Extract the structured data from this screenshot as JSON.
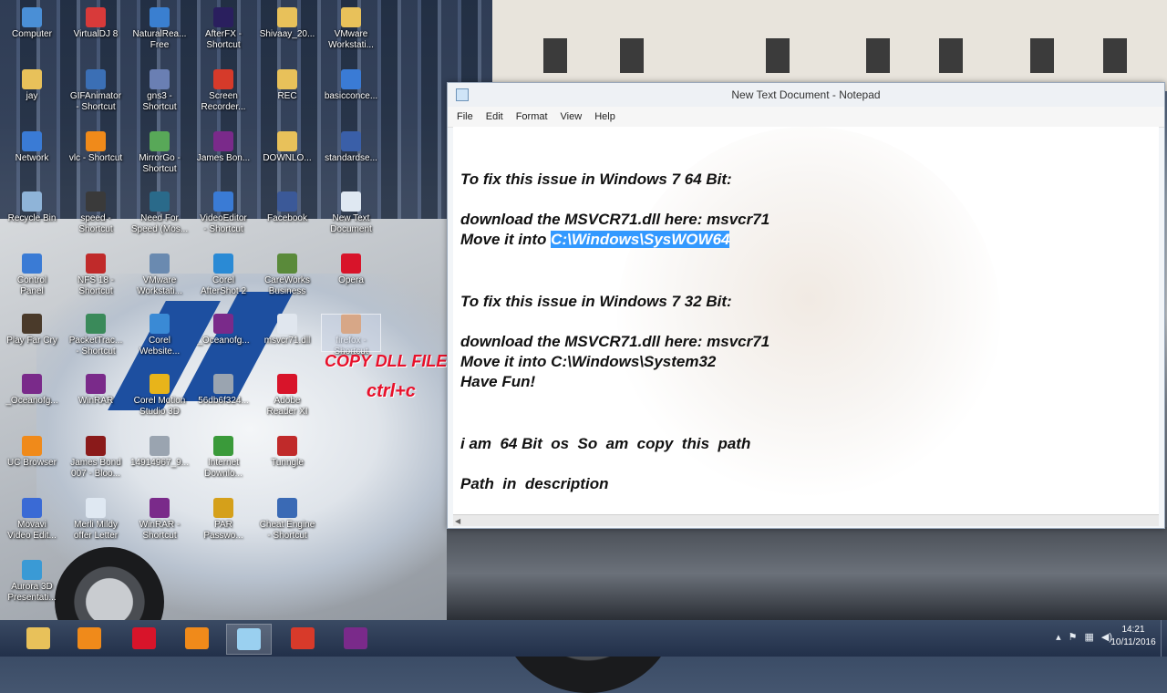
{
  "desktop": {
    "icons": [
      {
        "label": "Computer",
        "icon": "computer-icon",
        "color": "#4a8fd6"
      },
      {
        "label": "VirtualDJ 8",
        "icon": "virtualdj-icon",
        "color": "#d83a3a"
      },
      {
        "label": "NaturalRea...\nFree",
        "icon": "naturalreader-icon",
        "color": "#3a7fd0"
      },
      {
        "label": "AfterFX -\nShortcut",
        "icon": "aftereffects-icon",
        "color": "#2a1f5e"
      },
      {
        "label": "Shivaay_20...",
        "icon": "folder-icon",
        "color": "#e8c15a"
      },
      {
        "label": "VMware\nWorkstati...",
        "icon": "folder-icon",
        "color": "#e8c15a"
      },
      {
        "label": "jay",
        "icon": "folder-icon",
        "color": "#e8c15a"
      },
      {
        "label": "GIFAnimator\n- Shortcut",
        "icon": "gifanimator-icon",
        "color": "#3b6fb5"
      },
      {
        "label": "gns3 -\nShortcut",
        "icon": "gns3-icon",
        "color": "#6a7fb3"
      },
      {
        "label": "Screen\nRecorder...",
        "icon": "screen-recorder-icon",
        "color": "#d63a2a"
      },
      {
        "label": "REC",
        "icon": "folder-icon",
        "color": "#e8c15a"
      },
      {
        "label": "basicconce...",
        "icon": "document-icon",
        "color": "#3a7bd5"
      },
      {
        "label": "Network",
        "icon": "network-icon",
        "color": "#3a7bd5"
      },
      {
        "label": "vlc - Shortcut",
        "icon": "vlc-icon",
        "color": "#f08a1a"
      },
      {
        "label": "MirrorGo -\nShortcut",
        "icon": "mirrorgo-icon",
        "color": "#58a858"
      },
      {
        "label": "James Bon...",
        "icon": "winrar-icon",
        "color": "#7a2a8a"
      },
      {
        "label": "DOWNLO...",
        "icon": "pdf-icon",
        "color": "#e8c15a"
      },
      {
        "label": "standardse...",
        "icon": "setup-icon",
        "color": "#3a5fa8"
      },
      {
        "label": "Recycle Bin",
        "icon": "recycle-bin-icon",
        "color": "#8fb4d8"
      },
      {
        "label": "speed -\nShortcut",
        "icon": "game-icon",
        "color": "#3a3a3a"
      },
      {
        "label": "Need For\nSpeed (Mos...",
        "icon": "game-icon",
        "color": "#2a6a8a"
      },
      {
        "label": "VideoEditor\n- Shortcut",
        "icon": "video-editor-icon",
        "color": "#3a7bd5"
      },
      {
        "label": "Facebook",
        "icon": "facebook-icon",
        "color": "#3b5998"
      },
      {
        "label": "New Text\nDocument",
        "icon": "text-document-icon",
        "color": "#dfe8f2"
      },
      {
        "label": "Control\nPanel",
        "icon": "control-panel-icon",
        "color": "#3a7bd5"
      },
      {
        "label": "NFS 18 -\nShortcut",
        "icon": "game-icon",
        "color": "#c02a2a"
      },
      {
        "label": "VMware\nWorkstati...",
        "icon": "vmware-icon",
        "color": "#6a8ab0"
      },
      {
        "label": "Corel\nAfterShot 2",
        "icon": "corel-icon",
        "color": "#2a8ad5"
      },
      {
        "label": "CareWorks\nBusiness",
        "icon": "careworks-icon",
        "color": "#5a8a3a"
      },
      {
        "label": "Opera",
        "icon": "opera-icon",
        "color": "#d8142a"
      },
      {
        "label": "Play Far Cry",
        "icon": "farcry-icon",
        "color": "#4a3a2a"
      },
      {
        "label": "PacketTrac...\n- Shortcut",
        "icon": "packet-tracer-icon",
        "color": "#3a8a5a"
      },
      {
        "label": "Corel\nWebsite...",
        "icon": "globe-icon",
        "color": "#3a8ad5"
      },
      {
        "label": "_Oceanofg...",
        "icon": "winrar-icon",
        "color": "#7a2a8a"
      },
      {
        "label": "msvcr71.dll",
        "icon": "dll-file-icon",
        "color": "#e0e6ee"
      },
      {
        "label": "firefox -\nShortcut",
        "icon": "firefox-icon",
        "color": "#e8741a"
      },
      {
        "label": "_Oceanofg...",
        "icon": "winrar-icon",
        "color": "#7a2a8a"
      },
      {
        "label": "WinRAR",
        "icon": "winrar-icon",
        "color": "#7a2a8a"
      },
      {
        "label": "Corel Motion\nStudio 3D",
        "icon": "corel-motion-icon",
        "color": "#e8b41a"
      },
      {
        "label": "56db6f324...",
        "icon": "image-file-icon",
        "color": "#9aa4b0"
      },
      {
        "label": "Adobe\nReader XI",
        "icon": "adobe-reader-icon",
        "color": "#d8142a"
      },
      {
        "label": "UC Browser",
        "icon": "uc-browser-icon",
        "color": "#f08a1a"
      },
      {
        "label": "James Bond\n007 - Bloo...",
        "icon": "game-icon",
        "color": "#8a1a1a"
      },
      {
        "label": "14914967_9...",
        "icon": "image-file-icon",
        "color": "#9aa4b0"
      },
      {
        "label": "Internet\nDownlo...",
        "icon": "idm-icon",
        "color": "#3a9a3a"
      },
      {
        "label": "Tunngle",
        "icon": "tunngle-icon",
        "color": "#c02a2a"
      },
      {
        "label": "Movavi\nVideo Edit...",
        "icon": "movavi-icon",
        "color": "#3a6ad5"
      },
      {
        "label": "Merli Mildy\noffer Letter",
        "icon": "document-icon",
        "color": "#dfe8f2"
      },
      {
        "label": "WinRAR -\nShortcut",
        "icon": "winrar-icon",
        "color": "#7a2a8a"
      },
      {
        "label": "PAR\nPasswo...",
        "icon": "par-icon",
        "color": "#d5a01a"
      },
      {
        "label": "Cheat Engine\n- Shortcut",
        "icon": "cheat-engine-icon",
        "color": "#3a6ab5"
      },
      {
        "label": "Aurora 3D\nPresentati...",
        "icon": "aurora-icon",
        "color": "#3a9ad5"
      }
    ]
  },
  "overlay": {
    "copy_text": "COPY DLL FILE",
    "shortcut_text": "ctrl+c"
  },
  "notepad": {
    "title": "New Text Document - Notepad",
    "menu": [
      "File",
      "Edit",
      "Format",
      "View",
      "Help"
    ],
    "lines": {
      "l1": "To fix this issue in Windows 7 64 Bit:",
      "l2": "download the MSVCR71.dll here: msvcr71",
      "l3_prefix": "Move it into ",
      "l3_selected": "C:\\Windows\\SysWOW64",
      "l4": "To fix this issue in Windows 7 32 Bit:",
      "l5": "download the MSVCR71.dll here: msvcr71",
      "l6": "Move it into C:\\Windows\\System32",
      "l7": "Have Fun!",
      "l8": "i am  64 Bit  os  So  am  copy  this  path",
      "l9": "Path  in  description"
    },
    "selection_color": "#3399ff"
  },
  "taskbar": {
    "apps": [
      {
        "name": "file-explorer-icon",
        "color": "#e8c15a",
        "active": false
      },
      {
        "name": "media-player-icon",
        "color": "#f08a1a",
        "active": false
      },
      {
        "name": "opera-icon",
        "color": "#d8142a",
        "active": false
      },
      {
        "name": "uc-browser-icon",
        "color": "#f08a1a",
        "active": false
      },
      {
        "name": "notepad-icon",
        "color": "#9ad0f0",
        "active": true
      },
      {
        "name": "tiles-app-icon",
        "color": "#d83a2a",
        "active": false
      },
      {
        "name": "winrar-icon",
        "color": "#7a2a8a",
        "active": false
      }
    ],
    "clock": {
      "time": "14:21",
      "date": "10/11/2016"
    }
  }
}
